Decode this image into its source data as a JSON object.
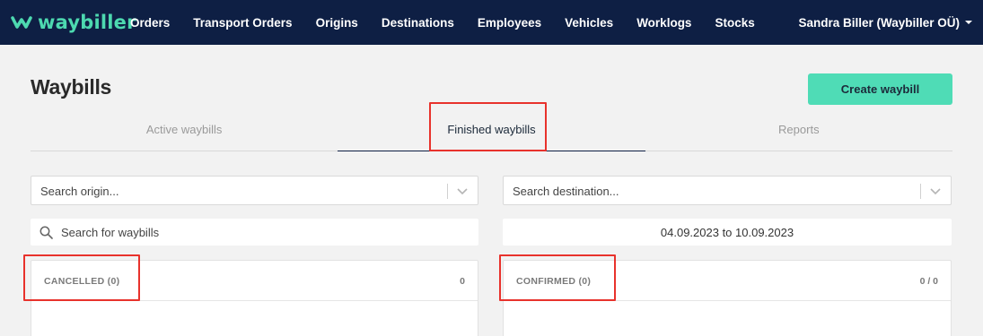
{
  "brand": {
    "name": "waybiller",
    "logo_color": "#4dd9b0"
  },
  "nav": {
    "items": [
      {
        "label": "Orders"
      },
      {
        "label": "Transport Orders"
      },
      {
        "label": "Origins"
      },
      {
        "label": "Destinations"
      },
      {
        "label": "Employees"
      },
      {
        "label": "Vehicles"
      },
      {
        "label": "Worklogs"
      },
      {
        "label": "Stocks"
      }
    ],
    "user": "Sandra Biller (Waybiller OÜ)",
    "user_icon": "chevron-down-icon"
  },
  "page": {
    "title": "Waybills",
    "create_button": "Create waybill"
  },
  "tabs": [
    {
      "label": "Active waybills",
      "active": false
    },
    {
      "label": "Finished waybills",
      "active": true
    },
    {
      "label": "Reports",
      "active": false
    }
  ],
  "filters": {
    "origin_placeholder": "Search origin...",
    "destination_placeholder": "Search destination...",
    "search_placeholder": "Search for waybills",
    "date_range": "04.09.2023 to 10.09.2023"
  },
  "panels": {
    "cancelled": {
      "title": "CANCELLED (0)",
      "count": "0"
    },
    "confirmed": {
      "title": "CONFIRMED (0)",
      "count": "0 / 0"
    }
  },
  "colors": {
    "topbar": "#0e1f44",
    "accent": "#4fdcb6",
    "highlight": "#e8322c"
  }
}
